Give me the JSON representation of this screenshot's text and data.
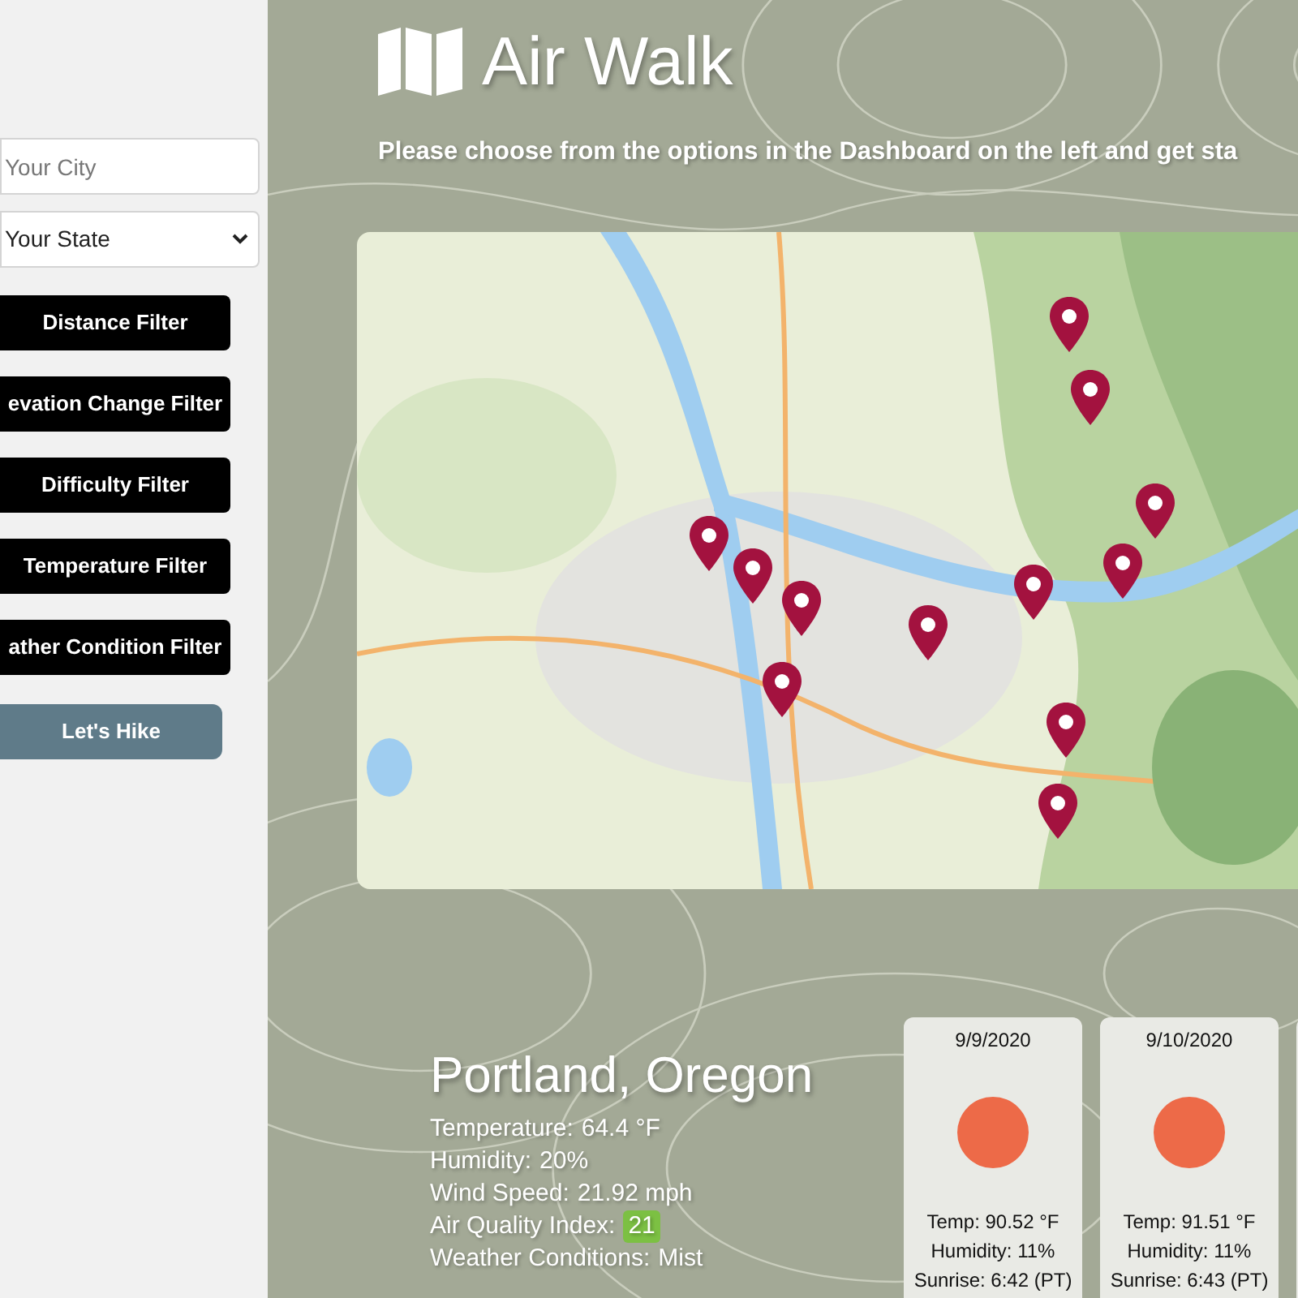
{
  "app": {
    "title": "Air Walk",
    "intro": "Please choose from the options in the Dashboard on the left and get sta"
  },
  "sidebar": {
    "city_field": {
      "placeholder": "Your City"
    },
    "state_select": {
      "value": "Your State"
    },
    "filters": [
      "Distance Filter",
      "evation Change Filter",
      "Difficulty Filter",
      "Temperature Filter",
      "ather Condition Filter"
    ],
    "submit": "Let's Hike"
  },
  "current": {
    "location": "Portland, Oregon",
    "stats": [
      {
        "kind": "text",
        "label": "Temperature:",
        "value": "64.4 °F"
      },
      {
        "kind": "text",
        "label": "Humidity:",
        "value": "20%"
      },
      {
        "kind": "text",
        "label": "Wind Speed:",
        "value": "21.92 mph"
      },
      {
        "kind": "badge",
        "label": "Air Quality Index:",
        "value": "21"
      },
      {
        "kind": "text",
        "label": "Weather Conditions:",
        "value": "Mist"
      }
    ]
  },
  "forecast": [
    {
      "date": "9/9/2020",
      "temp": "Temp: 90.52 °F",
      "humidity": "Humidity: 11%",
      "sunrise": "Sunrise: 6:42 (PT)"
    },
    {
      "date": "9/10/2020",
      "temp": "Temp: 91.51 °F",
      "humidity": "Humidity: 11%",
      "sunrise": "Sunrise: 6:43 (PT)"
    }
  ]
}
